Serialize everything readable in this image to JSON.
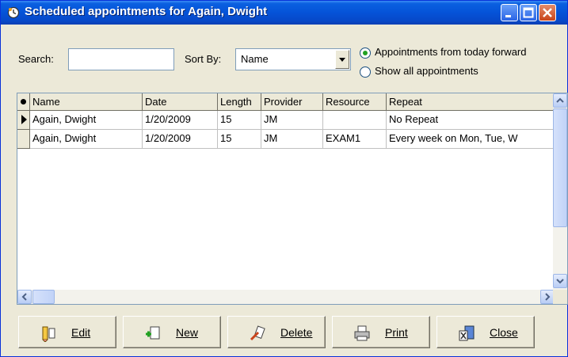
{
  "window": {
    "title": "Scheduled appointments for Again, Dwight"
  },
  "filters": {
    "search_label": "Search:",
    "search_value": "",
    "sortby_label": "Sort By:",
    "sortby_value": "Name",
    "radio_today": "Appointments from today forward",
    "radio_all": "Show all appointments",
    "selected_radio": "today"
  },
  "grid": {
    "columns": [
      "Name",
      "Date",
      "Length",
      "Provider",
      "Resource",
      "Repeat"
    ],
    "rows": [
      {
        "name": "Again, Dwight",
        "date": "1/20/2009",
        "length": "15",
        "provider": "JM",
        "resource": "",
        "repeat": "No Repeat"
      },
      {
        "name": "Again, Dwight",
        "date": "1/20/2009",
        "length": "15",
        "provider": "JM",
        "resource": "EXAM1",
        "repeat": "Every week on Mon, Tue, W"
      }
    ]
  },
  "buttons": {
    "edit": "Edit",
    "new": "New",
    "delete": "Delete",
    "print": "Print",
    "close": "Close"
  },
  "colors": {
    "title_bar": "#0553d8",
    "window_bg": "#ece9d8",
    "radio_checked": "#21a121"
  }
}
